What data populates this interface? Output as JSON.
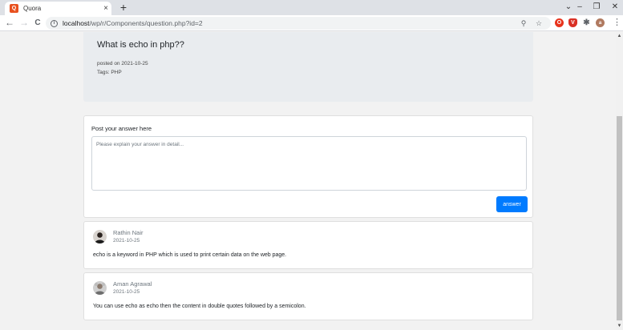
{
  "browser": {
    "tab_title": "Quora",
    "favicon_glyph": "Q",
    "tab_close": "×",
    "new_tab": "+",
    "url_host": "localhost",
    "url_path": "/wp/r/Components/question.php?id=2",
    "window_controls": {
      "collapse": "⌄",
      "minimize": "–",
      "restore": "❐",
      "close": "✕"
    },
    "nav": {
      "back": "←",
      "forward": "→",
      "reload": "C"
    },
    "omnibox_icons": {
      "zoom": "⚲",
      "bookmark": "☆"
    },
    "extensions": {
      "ext1": "O",
      "ext2": "V",
      "puzzle": "✱",
      "profile": "a"
    },
    "menu": "⋮"
  },
  "question": {
    "title": "What is echo in php??",
    "posted": "posted on 2021-10-25",
    "tags": "Tags: PHP"
  },
  "post_answer": {
    "label": "Post your answer here",
    "placeholder": "Please explain your answer in detail...",
    "button": "answer"
  },
  "answers": [
    {
      "name": "Rathin Nair",
      "date": "2021-10-25",
      "text": "echo is a keyword in PHP which is used to print certain data on the web page."
    },
    {
      "name": "Aman Agrawal",
      "date": "2021-10-25",
      "text": "You can use echo as echo then the content in double quotes followed by a semicolon."
    }
  ],
  "colors": {
    "primary_button": "#007bff",
    "jumbotron": "#e9ecef",
    "page_bg": "#f2f2f2"
  }
}
